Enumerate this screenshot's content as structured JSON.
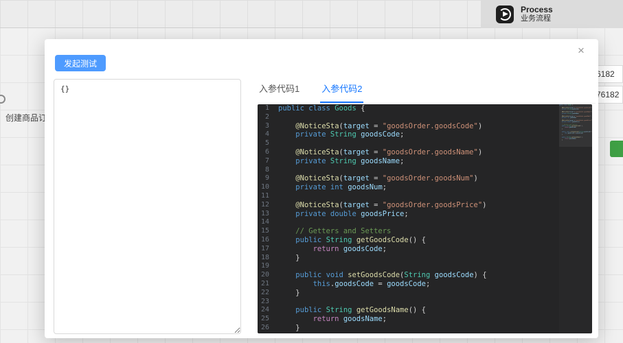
{
  "background": {
    "header": {
      "title": "Process",
      "subtitle": "业务流程"
    },
    "left_node_label": "创建商品订单",
    "chips": [
      "6182",
      "76182"
    ],
    "colors": {
      "green_button": "#3fa045",
      "header_bg": "#dcdcdc"
    }
  },
  "modal": {
    "test_button_label": "发起测试",
    "close_icon": "×",
    "input_value": "{}",
    "tabs": [
      {
        "label": "入参代码1",
        "active": false
      },
      {
        "label": "入参代码2",
        "active": true
      }
    ],
    "colors": {
      "accent_button": "#4e9bff",
      "tab_active": "#1677ff",
      "editor_bg": "#252526"
    },
    "editor": {
      "lines": [
        "public class Goods {",
        "",
        "    @NoticeSta(target = \"goodsOrder.goodsCode\")",
        "    private String goodsCode;",
        "",
        "    @NoticeSta(target = \"goodsOrder.goodsName\")",
        "    private String goodsName;",
        "",
        "    @NoticeSta(target = \"goodsOrder.goodsNum\")",
        "    private int goodsNum;",
        "",
        "    @NoticeSta(target = \"goodsOrder.goodsPrice\")",
        "    private double goodsPrice;",
        "",
        "    // Getters and Setters",
        "    public String getGoodsCode() {",
        "        return goodsCode;",
        "    }",
        "",
        "    public void setGoodsCode(String goodsCode) {",
        "        this.goodsCode = goodsCode;",
        "    }",
        "",
        "    public String getGoodsName() {",
        "        return goodsName;",
        "    }"
      ]
    }
  }
}
